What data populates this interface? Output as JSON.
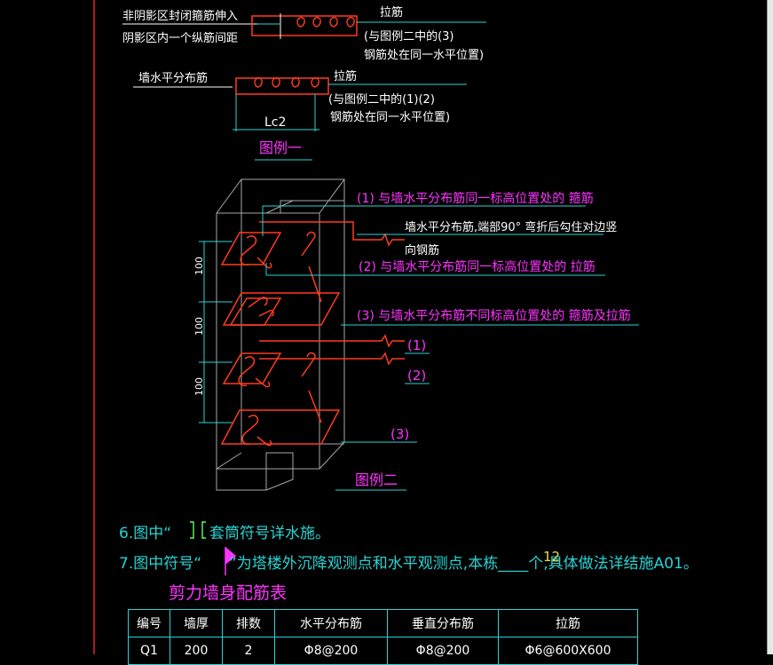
{
  "legend1": {
    "label_nonshadow": "非阴影区封闭箍筋伸入",
    "label_shadow": "阴影区内一个纵筋间距",
    "label_tie_top": "拉筋",
    "note_top_1": "(与图例二中的(3)",
    "note_top_2": "钢筋处在同一水平位置)",
    "label_wall_horizontal": "墙水平分布筋",
    "label_tie_mid": "拉筋",
    "note_mid_1": "(与图例二中的(1)(2)",
    "note_mid_2": "钢筋处在同一水平位置)",
    "dim_label": "Lc2",
    "title": "图例一"
  },
  "legend2": {
    "note_1": "(1)  与墙水平分布筋同一标高位置处的  箍筋",
    "note_wall_bar": "墙水平分布筋,端部90° 弯折后勾住对边竖",
    "note_vertical_bar": "向钢筋",
    "note_2": "(2)  与墙水平分布筋同一标高位置处的  拉筋",
    "note_3": "(3)  与墙水平分布筋不同标高位置处的  箍筋及拉筋",
    "marker_1": "(1)",
    "marker_2": "(2)",
    "marker_3": "(3)",
    "dims": [
      "100",
      "100",
      "100"
    ],
    "title": "图例二"
  },
  "notes": {
    "item6_prefix": "6.图中“",
    "item6_suffix": "套筒符号详水施。",
    "item7_prefix": "7.图中符号“",
    "item7_suffix": "”为塔楼外沉降观测点和水平观测点,本栋____个,具体做法详结施A01。",
    "overlay_number": "12"
  },
  "table": {
    "title": "剪力墙身配筋表",
    "headers": [
      "编号",
      "墙厚",
      "排数",
      "水平分布筋",
      "垂直分布筋",
      "拉筋"
    ],
    "rows": [
      [
        "Q1",
        "200",
        "2",
        "Φ8@200",
        "Φ8@200",
        "Φ6@600X600"
      ]
    ]
  },
  "colors": {
    "background": "#000000",
    "cyan": "#29d3d3",
    "magenta": "#ff33ff",
    "red": "#ff3b1f",
    "white": "#ffffff",
    "border": "#b01818",
    "grey": "#a8a8a8"
  }
}
